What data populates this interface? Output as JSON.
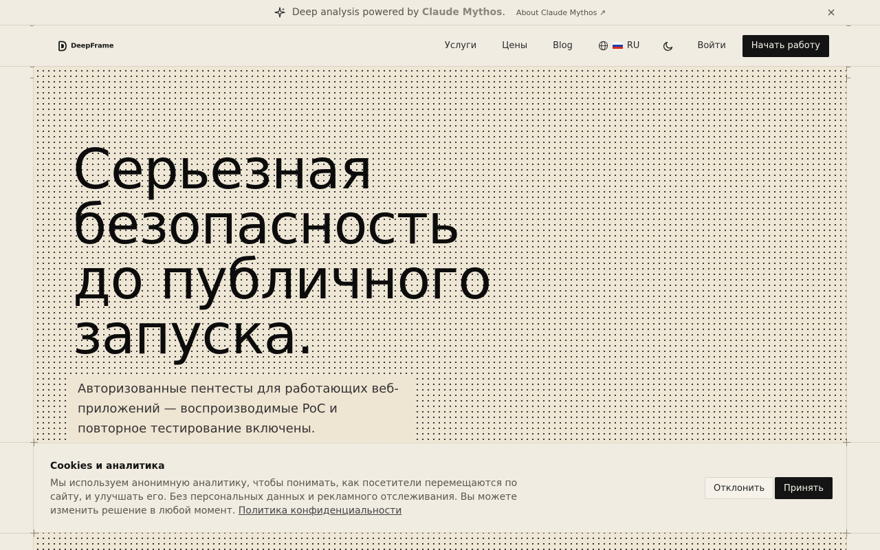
{
  "announcement": {
    "prefix": "Deep analysis powered by",
    "brand": "Claude Mythos",
    "suffix": ".",
    "link": "About Claude Mythos ↗",
    "icons": {
      "sparkle": "sparkle-icon",
      "close": "close-icon"
    }
  },
  "nav": {
    "logo_text": "DeepFrame",
    "links": [
      "Услуги",
      "Цены",
      "Blog"
    ],
    "language": "RU",
    "login": "Войти",
    "cta": "Начать работу",
    "icons": {
      "globe": "globe-icon",
      "flag": "flag-russia",
      "theme": "moon-icon"
    }
  },
  "hero": {
    "title_lines": [
      "Серьезная",
      "безопасность",
      "до публичного",
      "запуска."
    ],
    "subtitle": "Авторизованные пентесты для работающих веб-приложений — воспроизводимые PoC и повторное тестирование включены."
  },
  "cookie": {
    "title": "Cookies и аналитика",
    "text": "Мы используем анонимную аналитику, чтобы понимать, как посетители перемещаются по сайту, и улучшать его. Без персональных данных и рекламного отслеживания. Вы можете изменить решение в любой момент.",
    "policy_link": "Политика конфиденциальности",
    "decline": "Отклонить",
    "accept": "Принять"
  },
  "colors": {
    "background": "#f1ece2",
    "hero_background": "#efe7d6",
    "primary_button": "#141414",
    "text": "#141414"
  }
}
